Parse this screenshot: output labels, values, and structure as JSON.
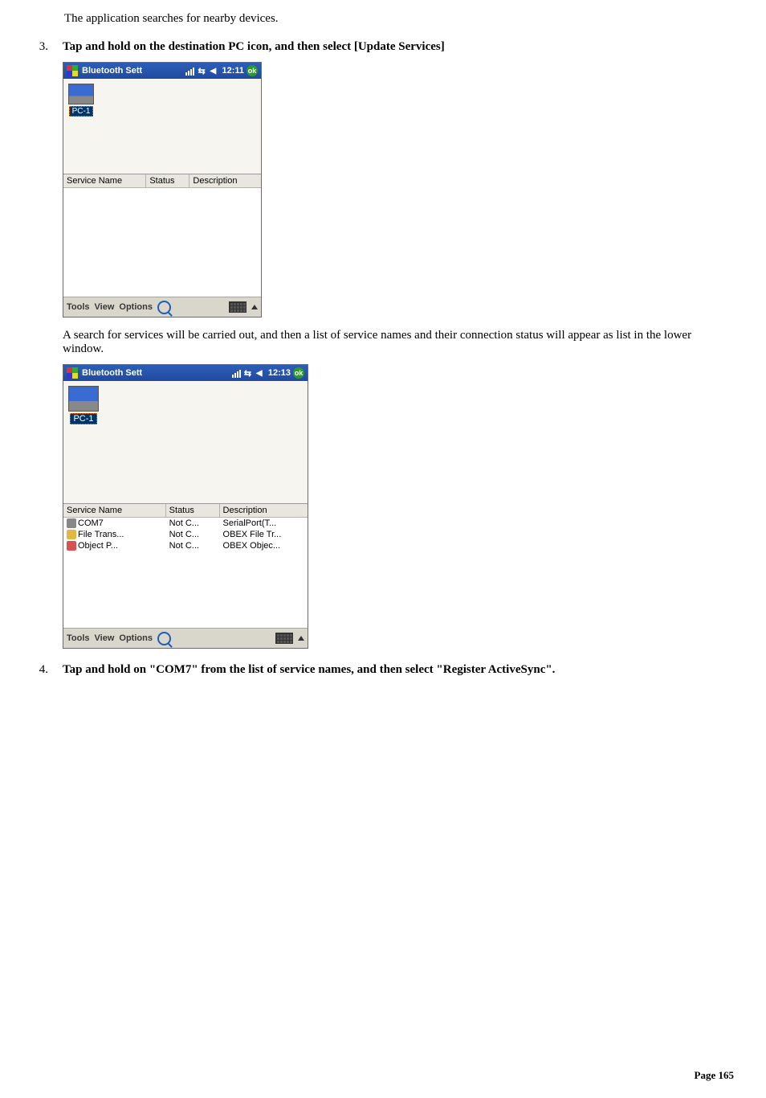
{
  "intro_text": "The application searches for nearby devices.",
  "steps": {
    "step3_num": "3.",
    "step3_text": "Tap and hold on the destination PC icon, and then select [Update Services]",
    "step4_num": "4.",
    "step4_text": "Tap and hold on \"COM7\" from the list of service names, and then select \"Register ActiveSync\"."
  },
  "between_text": "A search for services will be carried out, and then a list of service names and their connection status will appear as list in the lower window.",
  "screen1": {
    "title": "Bluetooth Sett",
    "time": "12:11",
    "ok": "ok",
    "device_label": "PC-1",
    "cols": {
      "svc": "Service Name",
      "stat": "Status",
      "desc": "Description"
    },
    "menu": {
      "tools": "Tools",
      "view": "View",
      "options": "Options"
    }
  },
  "screen2": {
    "title": "Bluetooth Sett",
    "time": "12:13",
    "ok": "ok",
    "device_label": "PC-1",
    "cols": {
      "svc": "Service Name",
      "stat": "Status",
      "desc": "Description"
    },
    "rows": [
      {
        "svc": "COM7",
        "stat": "Not C...",
        "desc": "SerialPort(T...",
        "icon": "plug"
      },
      {
        "svc": "File Trans...",
        "stat": "Not C...",
        "desc": "OBEX File Tr...",
        "icon": "file"
      },
      {
        "svc": "Object P...",
        "stat": "Not C...",
        "desc": "OBEX Objec...",
        "icon": "obj"
      }
    ],
    "menu": {
      "tools": "Tools",
      "view": "View",
      "options": "Options"
    }
  },
  "page_number": "Page 165"
}
